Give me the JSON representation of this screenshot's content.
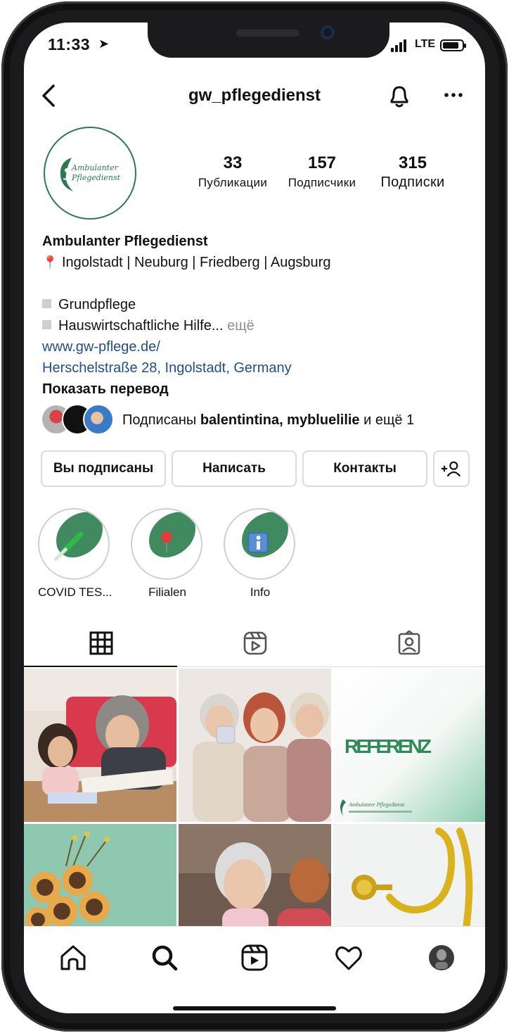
{
  "status_bar": {
    "time": "11:33",
    "network": "LTE"
  },
  "header": {
    "username": "gw_pflegedienst"
  },
  "avatar": {
    "logo_line1": "Ambulanter",
    "logo_line2": "Pflegedienst"
  },
  "stats": [
    {
      "value": "33",
      "label": "Публикации"
    },
    {
      "value": "157",
      "label": "Подписчики"
    },
    {
      "value": "315",
      "label": "Подписки"
    }
  ],
  "bio": {
    "name": "Ambulanter Pflegedienst",
    "location": "Ingolstadt | Neuburg | Friedberg | Augsburg",
    "item1": "Grundpflege",
    "item2": "Hauswirtschaftliche Hilfe...",
    "more": "ещё",
    "website": "www.gw-pflege.de/",
    "address": "Herschelstraße 28, Ingolstadt, Germany",
    "translate": "Показать перевод"
  },
  "followed_by": {
    "prefix": "Подписаны",
    "names": "balentintina, mybluelilie",
    "suffix": "и ещё 1"
  },
  "buttons": {
    "following": "Вы подписаны",
    "message": "Написать",
    "contacts": "Контакты"
  },
  "highlights": [
    {
      "label": "COVID TES..."
    },
    {
      "label": "Filialen"
    },
    {
      "label": "Info"
    }
  ],
  "grid": {
    "referenz_title": "REFERENZ",
    "referenz_brand": "Ambulanter Pflegedienst"
  },
  "colors": {
    "brand_green": "#3f8a5e",
    "link": "#1f4e8b"
  },
  "icons": [
    "back-icon",
    "bell-icon",
    "more-icon",
    "grid-icon",
    "reels-icon",
    "tagged-icon",
    "home-icon",
    "search-icon",
    "reels-nav-icon",
    "heart-icon",
    "profile-avatar"
  ]
}
